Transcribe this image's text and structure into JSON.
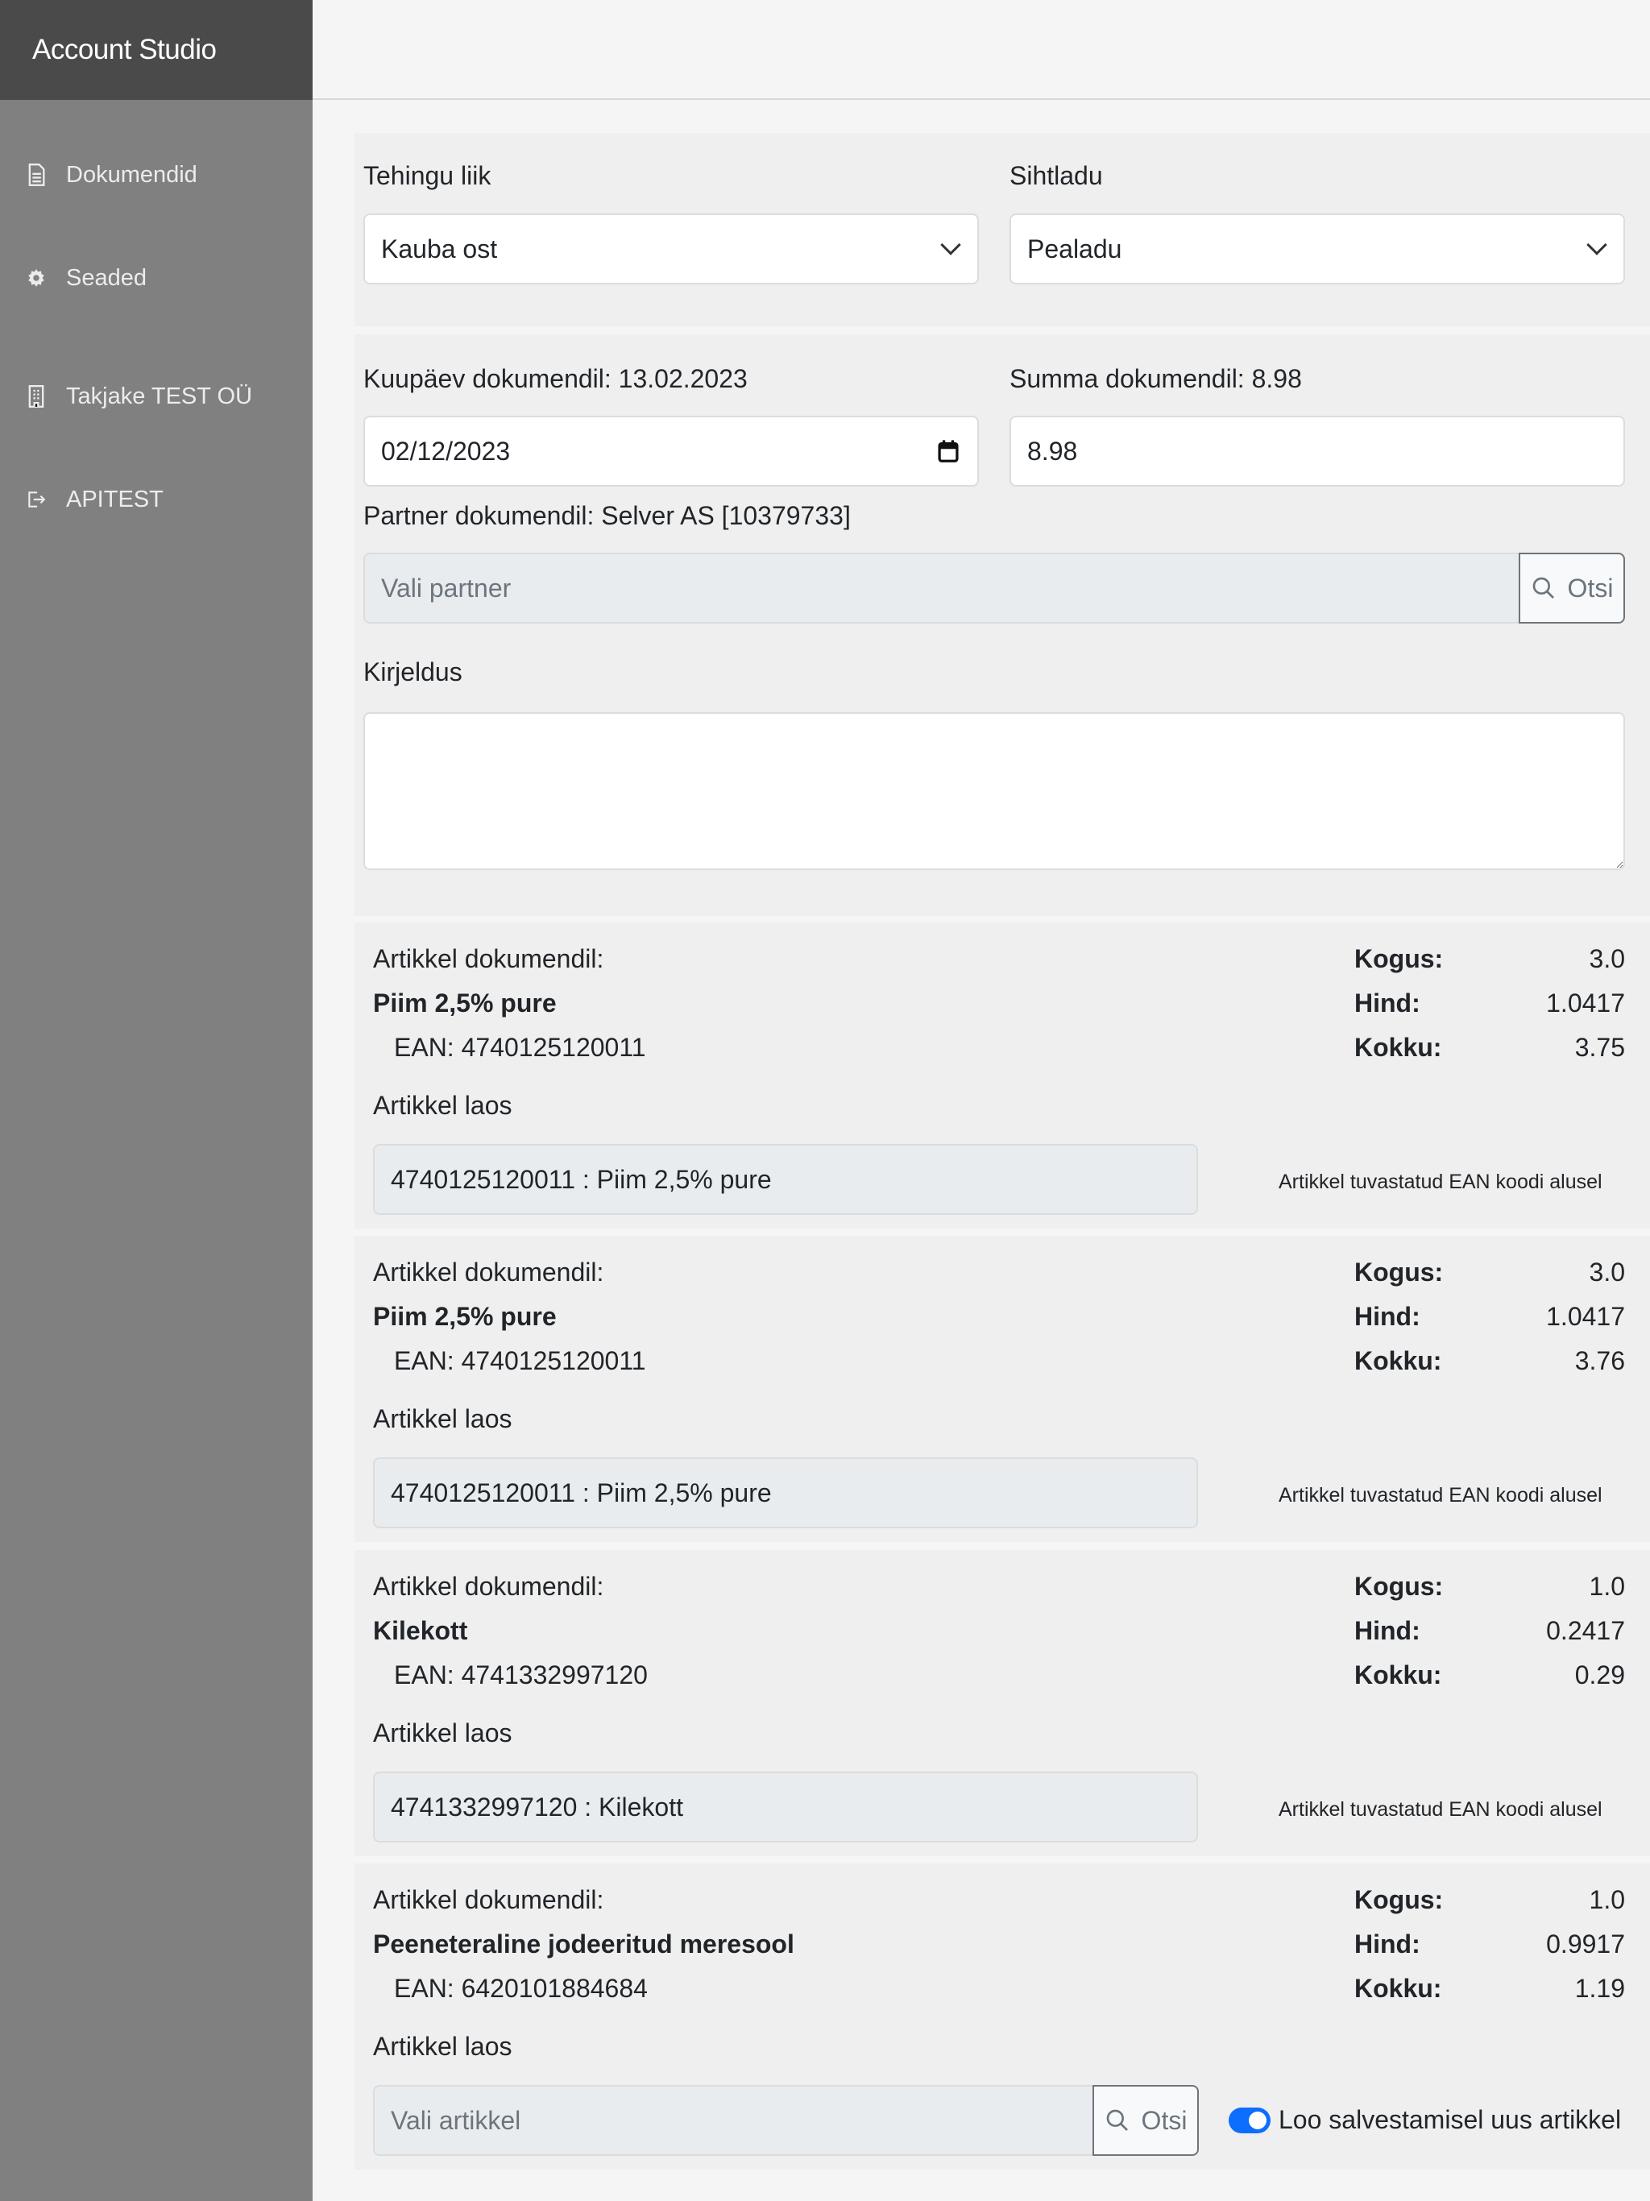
{
  "app": {
    "title": "Account Studio"
  },
  "sidebar": {
    "items": [
      {
        "label": "Dokumendid",
        "icon": "document-icon"
      },
      {
        "label": "Seaded",
        "icon": "gear-icon"
      },
      {
        "label": "Takjake TEST OÜ",
        "icon": "building-icon"
      },
      {
        "label": "APITEST",
        "icon": "logout-icon"
      }
    ]
  },
  "form": {
    "transaction_type_label": "Tehingu liik",
    "transaction_type_value": "Kauba ost",
    "warehouse_label": "Sihtladu",
    "warehouse_value": "Pealadu",
    "date_label": "Kuupäev dokumendil: 13.02.2023",
    "date_value": "02/12/2023",
    "sum_label": "Summa dokumendil: 8.98",
    "sum_value": "8.98",
    "partner_label": "Partner dokumendil: Selver AS [10379733]",
    "partner_placeholder": "Vali partner",
    "search_label": "Otsi",
    "description_label": "Kirjeldus",
    "description_value": ""
  },
  "items": [
    {
      "doc_label": "Artikkel dokumendil:",
      "name": "Piim 2,5% pure",
      "ean": "EAN: 4740125120011",
      "qty_label": "Kogus:",
      "qty": "3.0",
      "price_label": "Hind:",
      "price": "1.0417",
      "total_label": "Kokku:",
      "total": "3.75",
      "stock_label": "Artikkel laos",
      "stock_value": "4740125120011 : Piim 2,5% pure",
      "note": "Artikkel tuvastatud EAN koodi alusel"
    },
    {
      "doc_label": "Artikkel dokumendil:",
      "name": "Piim 2,5% pure",
      "ean": "EAN: 4740125120011",
      "qty_label": "Kogus:",
      "qty": "3.0",
      "price_label": "Hind:",
      "price": "1.0417",
      "total_label": "Kokku:",
      "total": "3.76",
      "stock_label": "Artikkel laos",
      "stock_value": "4740125120011 : Piim 2,5% pure",
      "note": "Artikkel tuvastatud EAN koodi alusel"
    },
    {
      "doc_label": "Artikkel dokumendil:",
      "name": "Kilekott",
      "ean": "EAN: 4741332997120",
      "qty_label": "Kogus:",
      "qty": "1.0",
      "price_label": "Hind:",
      "price": "0.2417",
      "total_label": "Kokku:",
      "total": "0.29",
      "stock_label": "Artikkel laos",
      "stock_value": "4741332997120 : Kilekott",
      "note": "Artikkel tuvastatud EAN koodi alusel"
    },
    {
      "doc_label": "Artikkel dokumendil:",
      "name": "Peeneteraline jodeeritud meresool",
      "ean": "EAN: 6420101884684",
      "qty_label": "Kogus:",
      "qty": "1.0",
      "price_label": "Hind:",
      "price": "0.9917",
      "total_label": "Kokku:",
      "total": "1.19",
      "stock_label": "Artikkel laos",
      "stock_placeholder": "Vali artikkel",
      "search_label": "Otsi",
      "toggle_label": "Loo salvestamisel uus artikkel",
      "toggle_on": true
    }
  ],
  "colors": {
    "accent": "#0d6efd",
    "sidebar": "#808080",
    "brand_bar": "#4a4a4a"
  }
}
